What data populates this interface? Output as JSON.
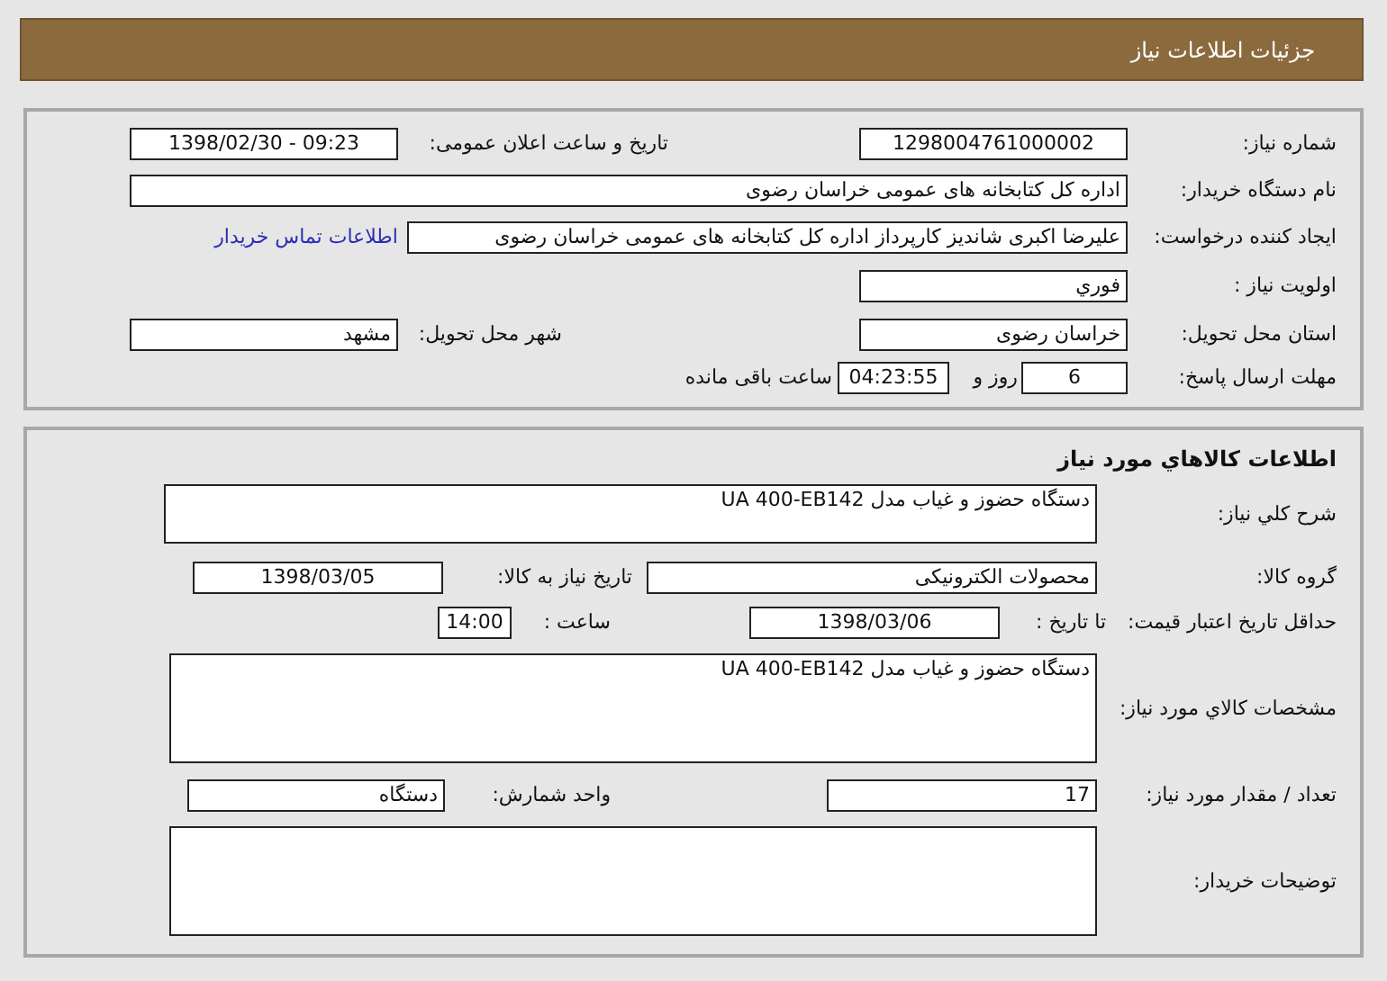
{
  "header": {
    "title": "جزئیات اطلاعات نیاز"
  },
  "need_info": {
    "rows": [
      {
        "items": [
          {
            "kind": "label",
            "text": "شماره نیاز:"
          },
          {
            "kind": "field",
            "value": "1298004761000002"
          },
          {
            "kind": "label",
            "text": "تاریخ و ساعت اعلان عمومی:"
          },
          {
            "kind": "field",
            "value": "1398/02/30 - 09:23"
          }
        ]
      },
      {
        "items": [
          {
            "kind": "label",
            "text": "نام دستگاه خریدار:"
          },
          {
            "kind": "field",
            "value": "اداره کل  کتابخانه های عمومی خراسان رضوی"
          }
        ]
      },
      {
        "items": [
          {
            "kind": "label",
            "text": "ایجاد کننده درخواست:"
          },
          {
            "kind": "field",
            "value": "علیرضا اکبری شاندیز کارپرداز اداره کل  کتابخانه های عمومی خراسان رضوی"
          },
          {
            "kind": "link",
            "text": "اطلاعات تماس خریدار"
          }
        ]
      },
      {
        "items": [
          {
            "kind": "label",
            "text": "اولویت نیاز :"
          },
          {
            "kind": "field",
            "value": "فوري"
          }
        ]
      },
      {
        "items": [
          {
            "kind": "label",
            "text": "استان محل تحویل:"
          },
          {
            "kind": "field",
            "value": "خراسان رضوی"
          },
          {
            "kind": "label",
            "text": "شهر محل تحویل:"
          },
          {
            "kind": "field",
            "value": "مشهد"
          }
        ]
      },
      {
        "items": [
          {
            "kind": "label",
            "text": "مهلت ارسال پاسخ:"
          },
          {
            "kind": "field",
            "value": "6"
          },
          {
            "kind": "label",
            "text": "روز و"
          },
          {
            "kind": "field",
            "value": "04:23:55"
          },
          {
            "kind": "label",
            "text": "ساعت باقی مانده"
          }
        ]
      }
    ]
  },
  "goods_info": {
    "title": "اطلاعات کالاهاي مورد نياز",
    "rows": [
      {
        "items": [
          {
            "kind": "label",
            "text": "شرح کلي نياز:"
          },
          {
            "kind": "field",
            "value": "دستگاه حضوز و غیاب مدل UA 400-EB142"
          }
        ]
      },
      {
        "items": [
          {
            "kind": "label",
            "text": "گروه کالا:"
          },
          {
            "kind": "field",
            "value": "محصولات الکترونیکی"
          },
          {
            "kind": "label",
            "text": "تاریخ نیاز به کالا:"
          },
          {
            "kind": "field",
            "value": "1398/03/05"
          }
        ]
      },
      {
        "items": [
          {
            "kind": "label",
            "text": "حداقل تاریخ اعتبار قیمت:"
          },
          {
            "kind": "label",
            "text": "تا تاریخ :"
          },
          {
            "kind": "field",
            "value": "1398/03/06"
          },
          {
            "kind": "label",
            "text": "ساعت :"
          },
          {
            "kind": "field",
            "value": "14:00"
          }
        ]
      },
      {
        "items": [
          {
            "kind": "label",
            "text": "مشخصات کالاي مورد نياز:"
          },
          {
            "kind": "field",
            "value": "دستگاه حضوز و غیاب مدل UA 400-EB142"
          }
        ]
      },
      {
        "items": [
          {
            "kind": "label",
            "text": "تعداد / مقدار مورد نیاز:"
          },
          {
            "kind": "field",
            "value": "17"
          },
          {
            "kind": "label",
            "text": "واحد شمارش:"
          },
          {
            "kind": "field",
            "value": "دستگاه"
          }
        ]
      },
      {
        "items": [
          {
            "kind": "label",
            "text": "توضيحات خريدار:"
          },
          {
            "kind": "field"
          }
        ]
      }
    ]
  }
}
